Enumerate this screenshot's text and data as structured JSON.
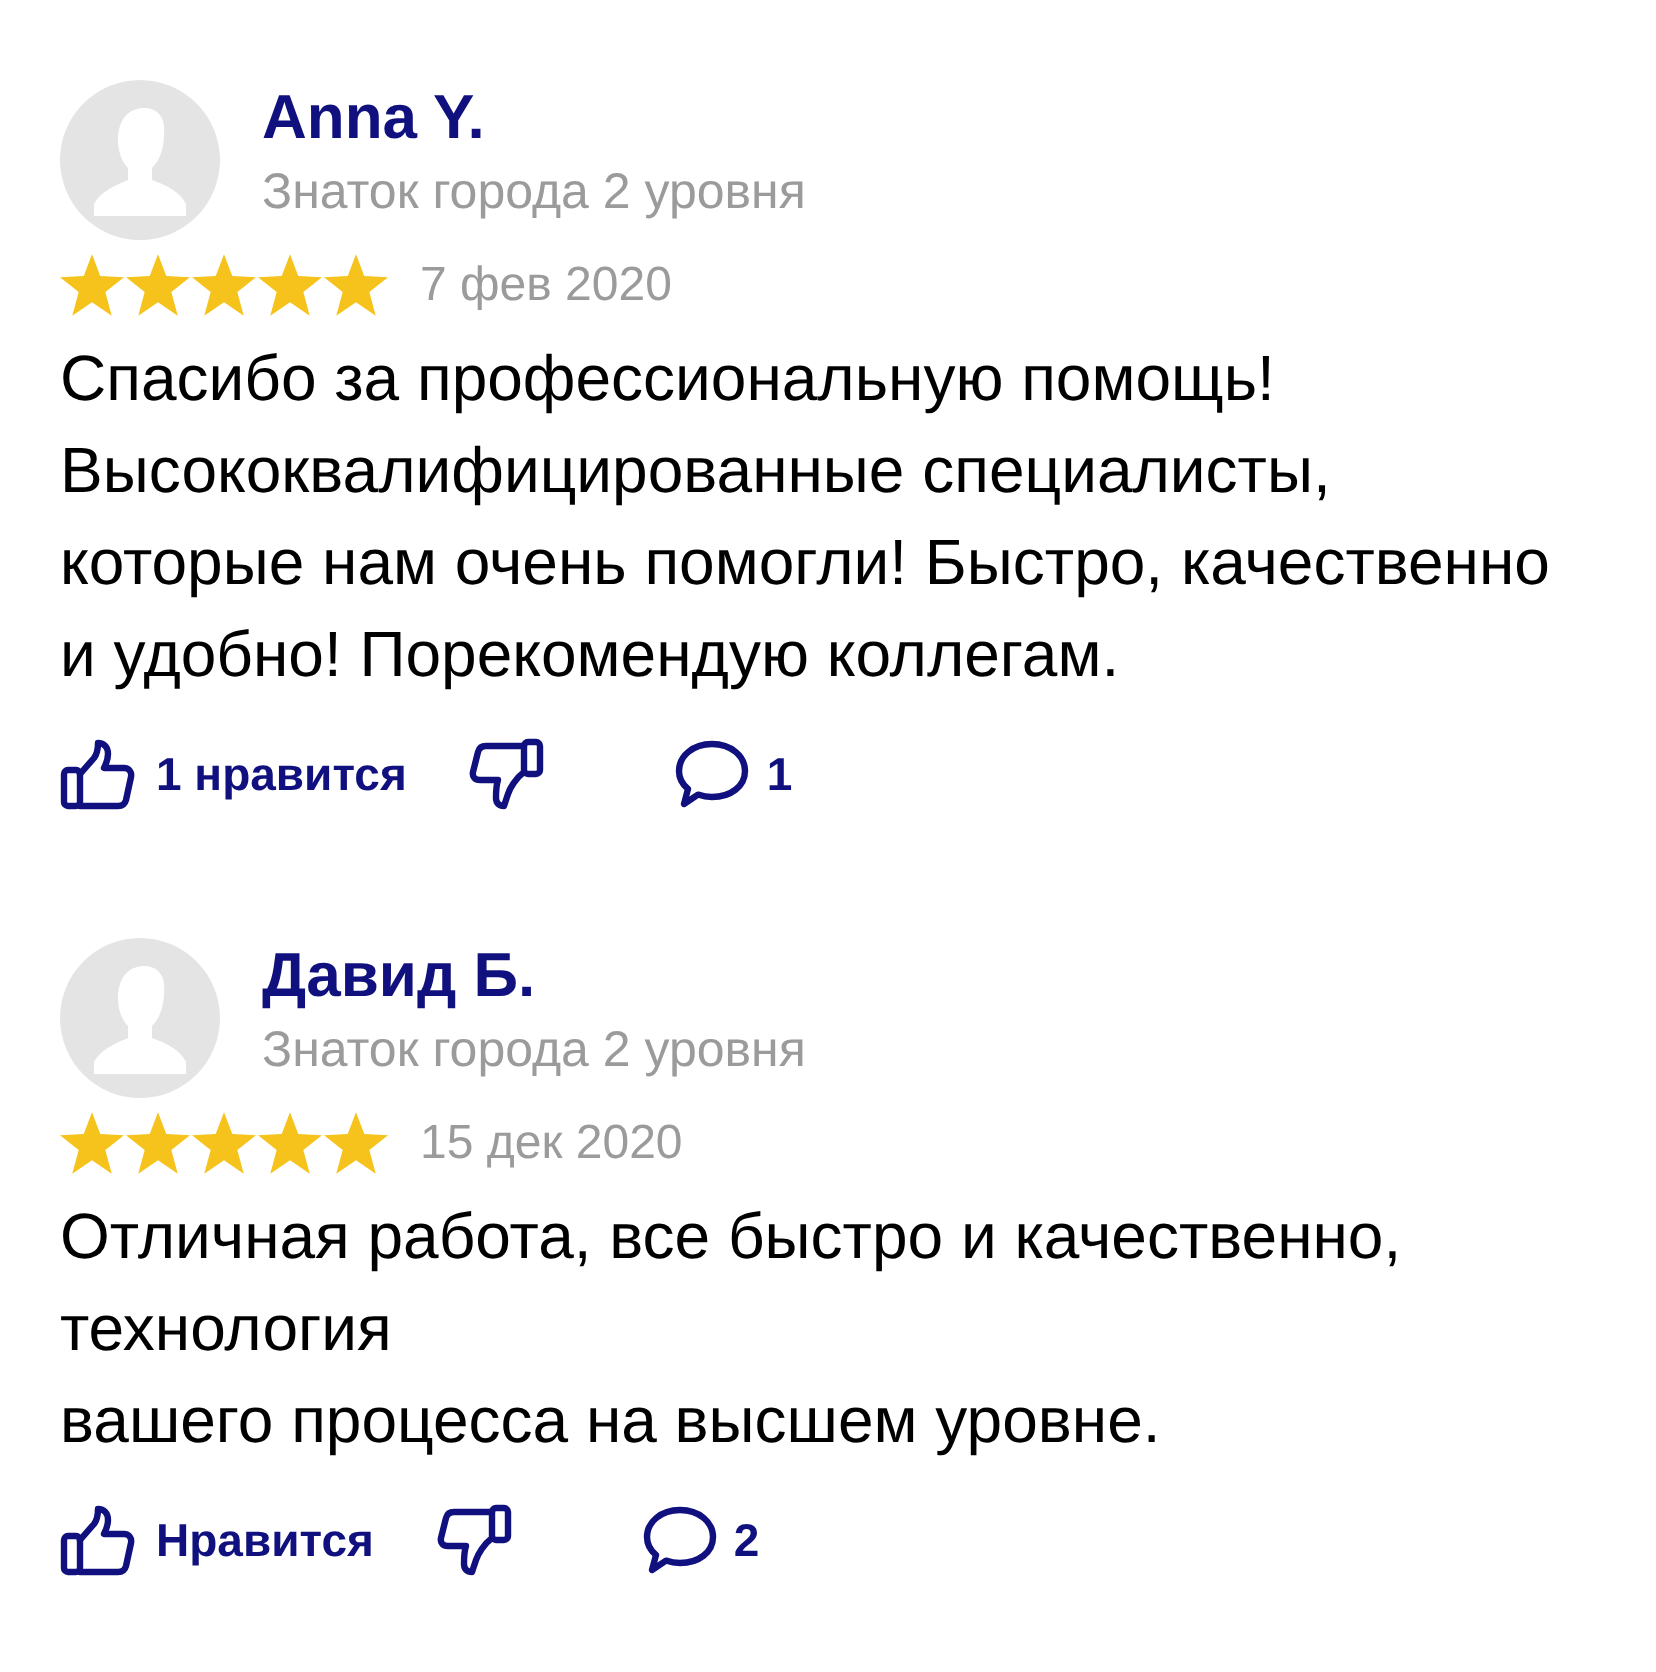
{
  "reviews": [
    {
      "author": "Anna Y.",
      "badge": "Знаток города 2 уровня",
      "stars": 5,
      "date": "7 фев 2020",
      "text": "Спасибо за профессиональную помощь!\nВысококвалифицированные специалисты,\nкоторые нам очень помогли! Быстро, качественно\nи удобно! Порекомендую коллегам.",
      "like_label": "1 нравится",
      "comment_count": "1"
    },
    {
      "author": "Давид Б.",
      "badge": "Знаток города 2 уровня",
      "stars": 5,
      "date": "15 дек 2020",
      "text": "Отличная работа, все быстро и качественно,\nтехнология\nвашего процесса на высшем уровне.",
      "like_label": "Нравится",
      "comment_count": "2"
    }
  ]
}
